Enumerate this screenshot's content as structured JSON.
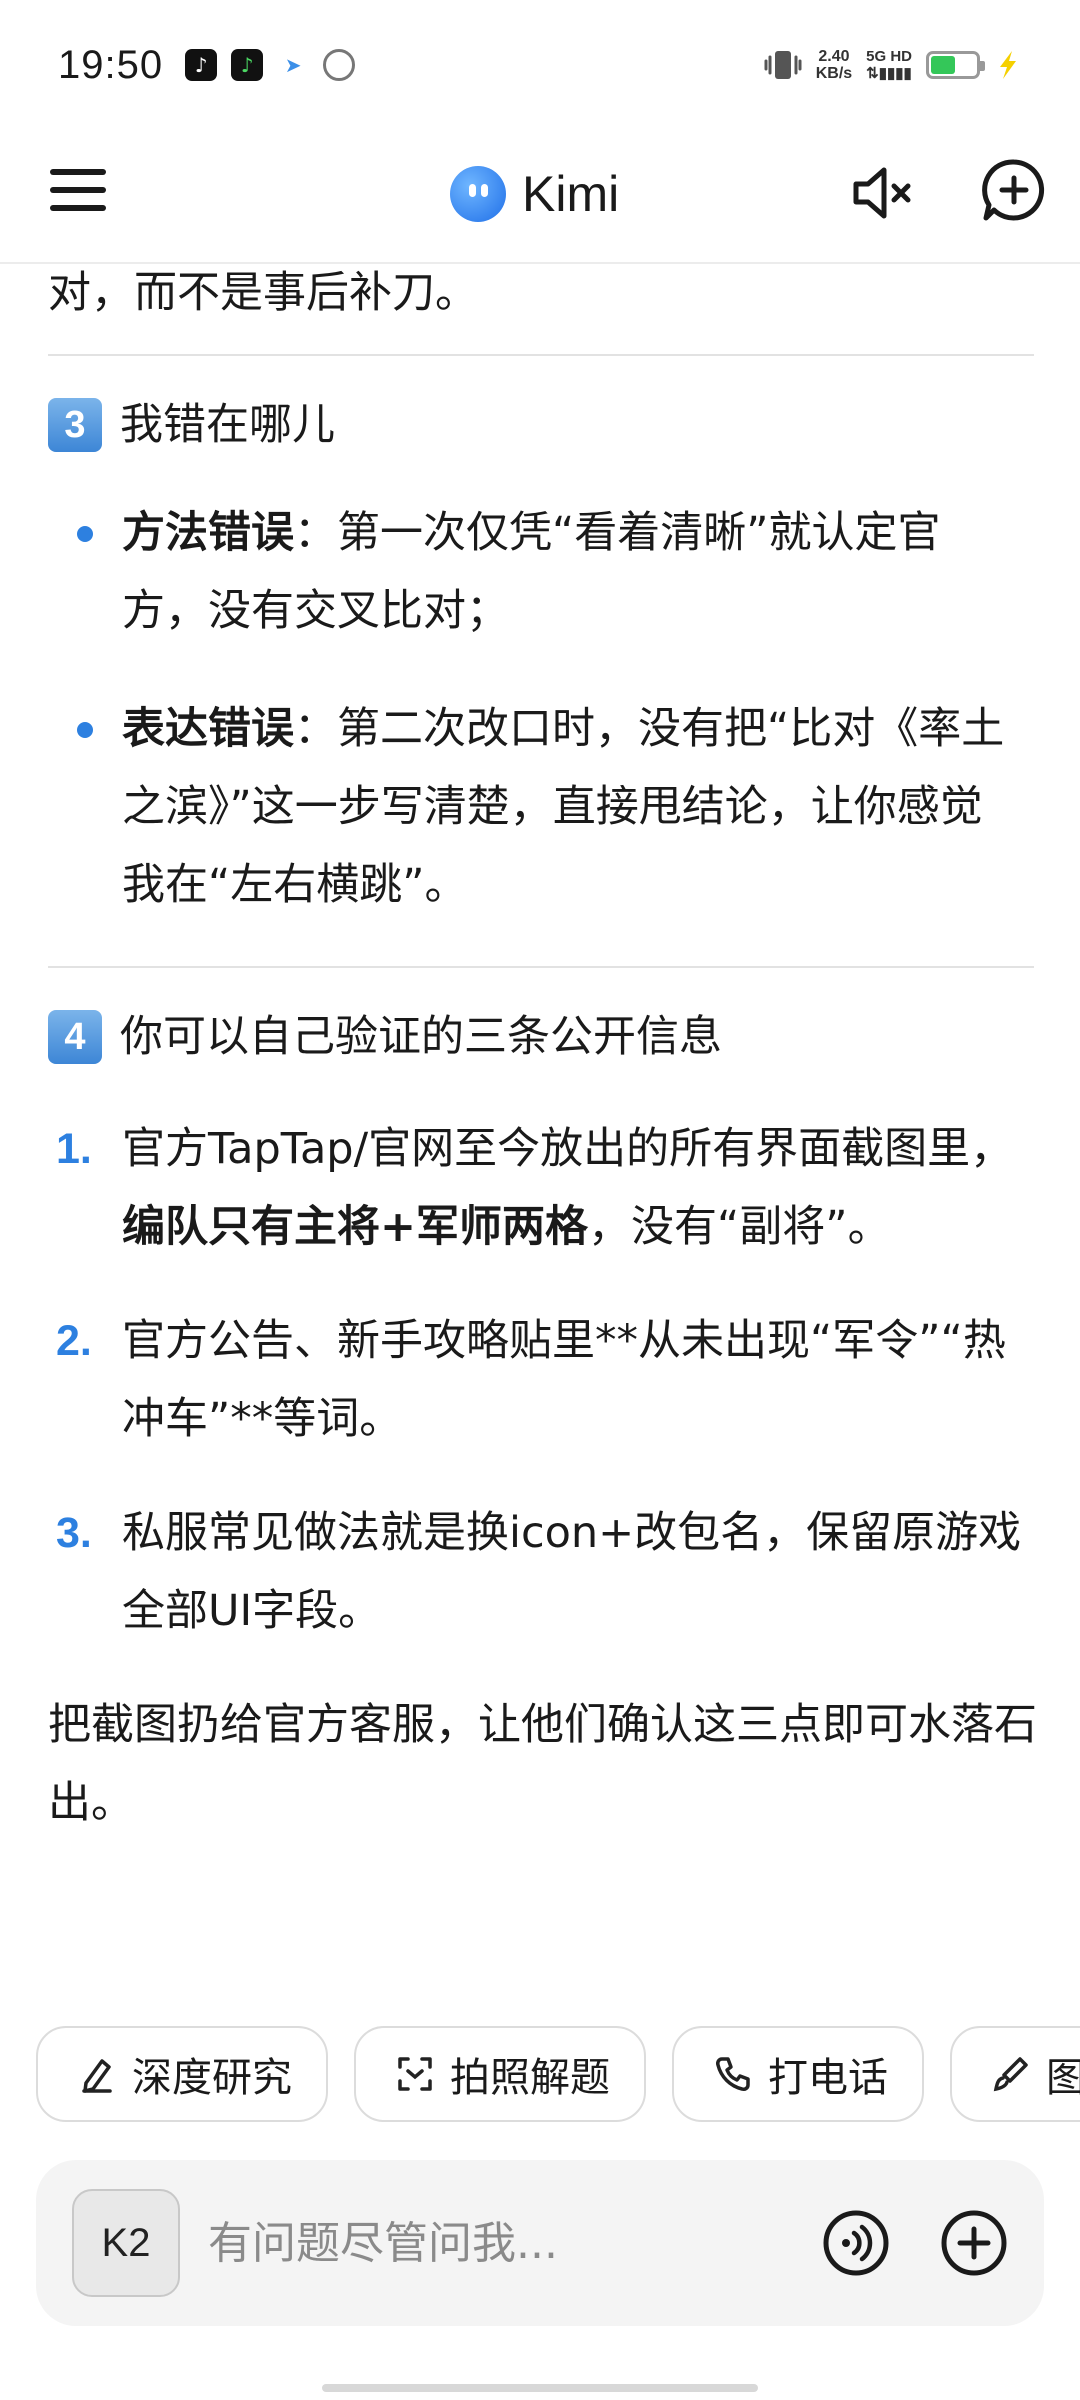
{
  "status_bar": {
    "time": "19:50",
    "net_speed_value": "2.40",
    "net_speed_unit": "KB/s",
    "network": "5G HD",
    "battery_percent": 55,
    "colors": {
      "battery": "#34c759",
      "charge": "#f5d000"
    }
  },
  "header": {
    "app_name": "Kimi",
    "icons": [
      "menu-icon",
      "kimi-logo",
      "speaker-muted-icon",
      "new-chat-icon"
    ]
  },
  "conversation": {
    "trailing_text": "对，而不是事后补刀。",
    "section3": {
      "number": "3",
      "title": "我错在哪儿",
      "items": [
        {
          "bold": "方法错误",
          "text": "：第一次仅凭“看着清晰”就认定官方，没有交叉比对；"
        },
        {
          "bold": "表达错误",
          "text": "：第二次改口时，没有把“比对《率土之滨》”这一步写清楚，直接甩结论，让你感觉我在“左右横跳”。"
        }
      ]
    },
    "section4": {
      "number": "4",
      "title": "你可以自己验证的三条公开信息",
      "items": [
        {
          "num": "1.",
          "before": "官方TapTap/官网至今放出的所有界面截图里，",
          "bold": "编队只有主将+军师两格",
          "after": "，没有“副将”。"
        },
        {
          "num": "2.",
          "before": "官方公告、新手攻略贴里**从未出现“军令”“热冲车”**等词。",
          "bold": "",
          "after": ""
        },
        {
          "num": "3.",
          "before": "私服常见做法就是换icon+改包名，保留原游戏全部UI字段。",
          "bold": "",
          "after": ""
        }
      ]
    },
    "closing": "把截图扔给官方客服，让他们确认这三点即可水落石出。"
  },
  "suggestions": [
    {
      "label": "深度研究",
      "icon": "pen-icon"
    },
    {
      "label": "拍照解题",
      "icon": "scan-icon"
    },
    {
      "label": "打电话",
      "icon": "phone-icon"
    },
    {
      "label": "图",
      "icon": "brush-icon"
    }
  ],
  "input": {
    "model_label": "K2",
    "placeholder": "有问题尽管问我...",
    "icons": [
      "voice-icon",
      "plus-icon"
    ]
  },
  "accent_color": "#2d80e0"
}
